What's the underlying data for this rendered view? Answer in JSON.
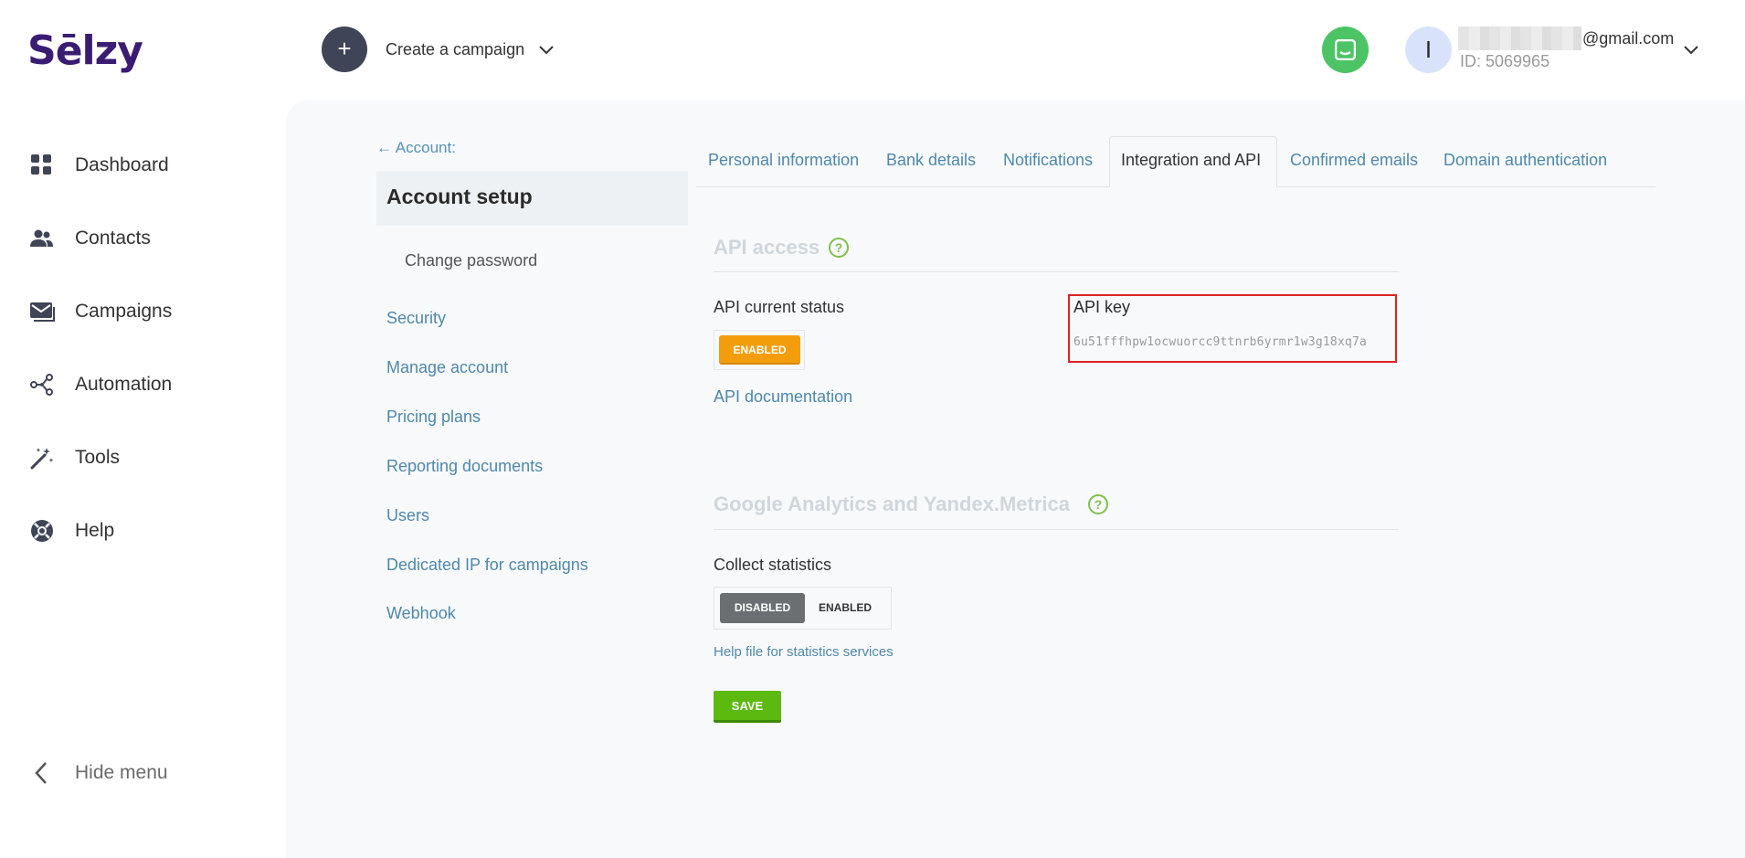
{
  "header": {
    "logo_text": "Sēlzy",
    "create_label": "Create a campaign",
    "avatar_initial": "I",
    "email_tail": "@gmail.com",
    "user_id": "ID: 5069965"
  },
  "sidebar": {
    "items": [
      {
        "label": "Dashboard",
        "icon": "grid-icon"
      },
      {
        "label": "Contacts",
        "icon": "contacts-icon"
      },
      {
        "label": "Campaigns",
        "icon": "envelope-icon"
      },
      {
        "label": "Automation",
        "icon": "automation-icon"
      },
      {
        "label": "Tools",
        "icon": "magic-wand-icon"
      },
      {
        "label": "Help",
        "icon": "lifebuoy-icon"
      }
    ],
    "hide_menu": "Hide menu"
  },
  "account_nav": {
    "back": "← Account:",
    "title": "Account setup",
    "change_password": "Change password",
    "links": [
      "Security",
      "Manage account",
      "Pricing plans",
      "Reporting documents",
      "Users",
      "Dedicated IP for campaigns",
      "Webhook"
    ]
  },
  "tabs": [
    "Personal information",
    "Bank details",
    "Notifications",
    "Integration and API",
    "Confirmed emails",
    "Domain authentication"
  ],
  "active_tab": "Integration and API",
  "api_section": {
    "title": "API access",
    "status_label": "API current status",
    "status_value": "ENABLED",
    "doc_link": "API documentation",
    "key_label": "API key",
    "key_value": "6u51fffhpw1ocwuorcc9ttnrb6yrmr1w3g18xq7a"
  },
  "analytics_section": {
    "title": "Google Analytics and Yandex.Metrica",
    "collect_label": "Collect statistics",
    "toggle_disabled": "DISABLED",
    "toggle_enabled": "ENABLED",
    "help_link": "Help file for statistics services",
    "save": "SAVE"
  },
  "colors": {
    "brand": "#3a1c72",
    "accent_green": "#4cc465",
    "link": "#4f88aa",
    "enabled_orange": "#f49d0c",
    "save_green": "#5cb90f",
    "highlight_red": "#e02020"
  }
}
